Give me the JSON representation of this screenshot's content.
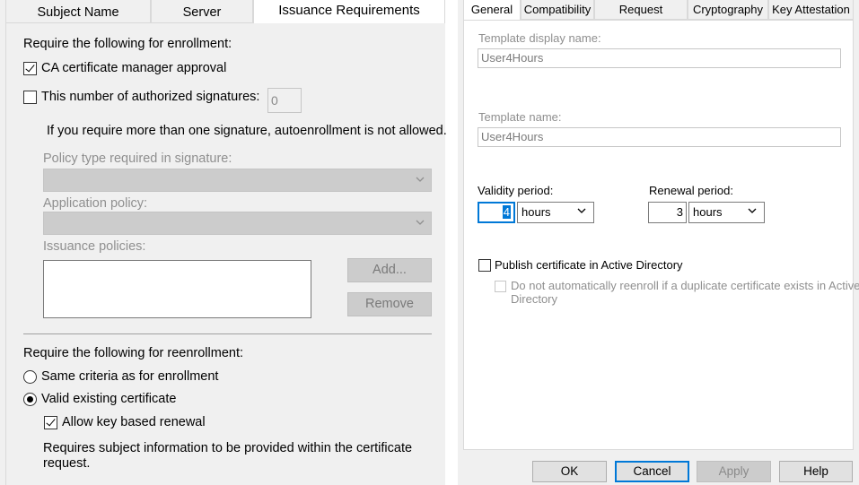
{
  "left": {
    "tabs": [
      {
        "label": "Subject Name"
      },
      {
        "label": "Server"
      },
      {
        "label": "Issuance Requirements"
      }
    ],
    "enrollment_heading": "Require the following for enrollment:",
    "ca_manager_approval": {
      "label": "CA certificate manager approval",
      "checked": true
    },
    "authorized_signatures": {
      "label": "This number of authorized signatures:",
      "checked": false,
      "value": "0"
    },
    "signature_note": "If you require more than one signature, autoenrollment is not allowed.",
    "policy_type_label": "Policy type required in signature:",
    "application_policy_label": "Application policy:",
    "issuance_policies_label": "Issuance policies:",
    "add_button": "Add...",
    "remove_button": "Remove",
    "reenrollment_heading": "Require the following for reenrollment:",
    "same_criteria": {
      "label": "Same criteria as for enrollment",
      "selected": false
    },
    "valid_existing": {
      "label": "Valid existing certificate",
      "selected": true
    },
    "allow_key_renewal": {
      "label": "Allow key based renewal",
      "checked": true
    },
    "subject_info_note_line1": "Requires subject information to be provided within the certificate",
    "subject_info_note_line2": "request."
  },
  "right": {
    "tabs": [
      {
        "label": "General"
      },
      {
        "label": "Compatibility"
      },
      {
        "label": "Request Handling"
      },
      {
        "label": "Cryptography"
      },
      {
        "label": "Key Attestation"
      }
    ],
    "display_name_label": "Template display name:",
    "display_name_value": "User4Hours",
    "template_name_label": "Template name:",
    "template_name_value": "User4Hours",
    "validity_label": "Validity period:",
    "validity_value": "4",
    "validity_unit": "hours",
    "renewal_label": "Renewal period:",
    "renewal_value": "3",
    "renewal_unit": "hours",
    "publish_label": "Publish certificate in Active Directory",
    "publish_checked": false,
    "no_reenroll_line1": "Do not automatically reenroll if a duplicate certificate exists in Active",
    "no_reenroll_line2": "Directory",
    "buttons": {
      "ok": "OK",
      "cancel": "Cancel",
      "apply": "Apply",
      "help": "Help"
    }
  },
  "icons": {
    "dropdown": "chevron-down-icon",
    "check": "checkmark-icon"
  },
  "colors": {
    "focus_border": "#0078d7",
    "panel_bg": "#f0f0f0",
    "disabled_fill": "#cccccc"
  }
}
